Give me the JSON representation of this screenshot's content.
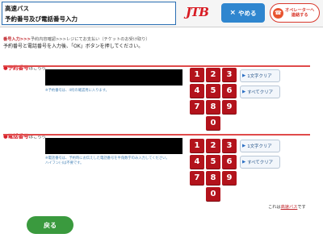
{
  "header": {
    "title_line1": "高速バス",
    "title_line2": "予約番号及び電話番号入力",
    "logo": "JTB",
    "close_label": "やめる",
    "close_icon": "×",
    "operator_line1": "オペレーターへ",
    "operator_line2": "連絡する"
  },
  "breadcrumb": {
    "current": "番号入力",
    "separator": ">>>",
    "rest": "予約内容確認>>>レジにてお支払い（チケットのお受け取り）"
  },
  "instruction": "予約番号と電話番号を入力後、「OK」ボタンを押してください。",
  "sections": [
    {
      "title": "予約番号",
      "suffix": "はこちら",
      "note_line1": "※予約番号は、4桁の確認用に入ります。",
      "note_line2": "",
      "clear_one": "1文字クリア",
      "clear_all": "すべてクリア"
    },
    {
      "title": "電話番号",
      "suffix": "はこちら",
      "note_line1": "※電話番号は、予約時にお伝えした電話番号を半角数字のみ入力してください。",
      "note_line2": "ハイフン(-)は不要です。",
      "clear_one": "1文字クリア",
      "clear_all": "すべてクリア"
    }
  ],
  "keypad": [
    "1",
    "2",
    "3",
    "4",
    "5",
    "6",
    "7",
    "8",
    "9",
    "0"
  ],
  "footer": {
    "note_prefix": "これは",
    "note_link": "高速バス",
    "note_suffix": "です",
    "back_label": "戻る"
  },
  "colors": {
    "accent_red": "#d8202a",
    "key_red": "#b3131c",
    "close_blue": "#2f86cf",
    "back_green": "#3a9a3e"
  }
}
